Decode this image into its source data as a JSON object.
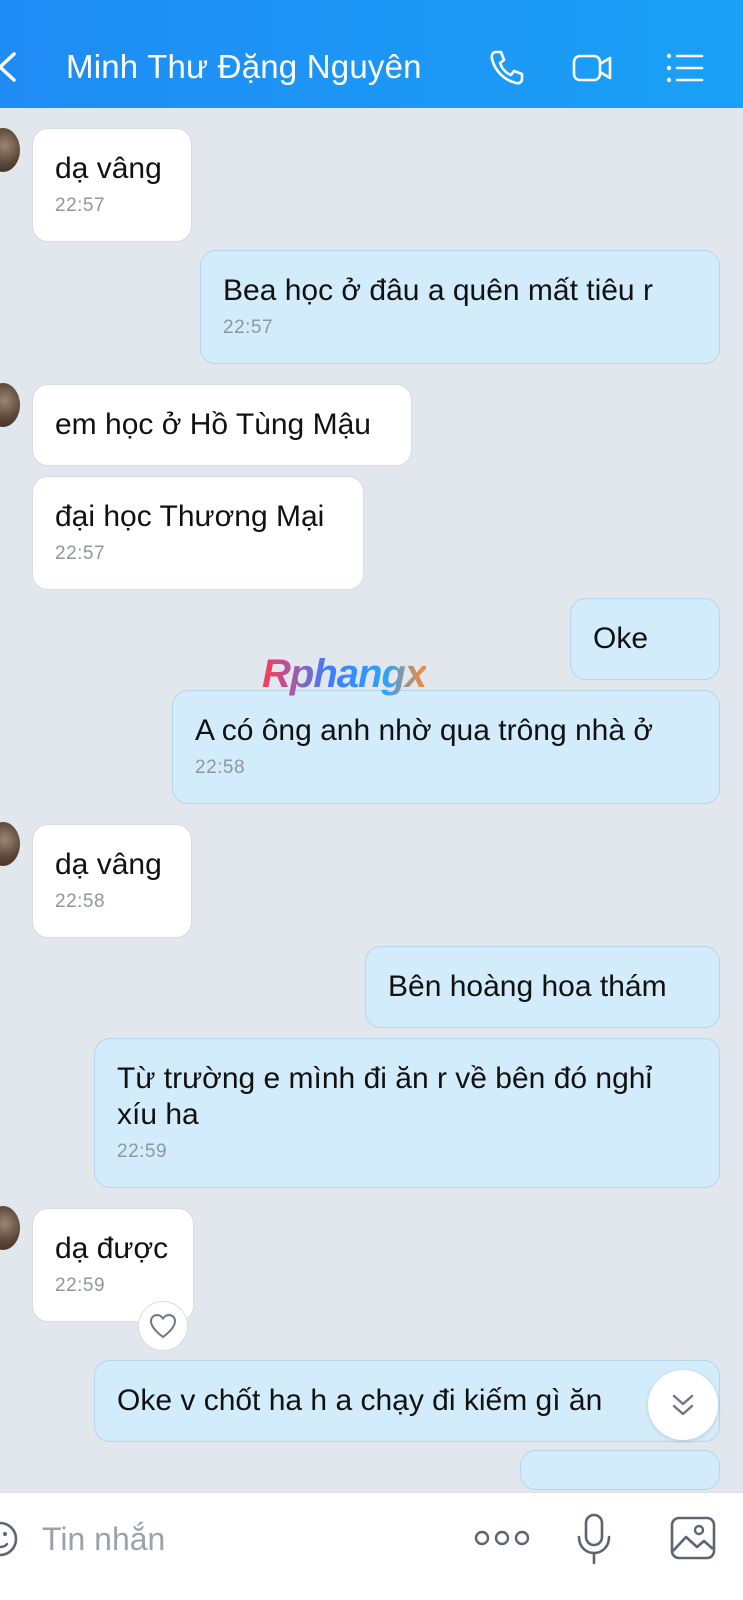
{
  "header": {
    "title": "Minh Thư Đặng Nguyên",
    "icons": [
      "back-icon",
      "phone-icon",
      "video-call-icon",
      "menu-list-icon"
    ]
  },
  "messages": [
    {
      "side": "in",
      "text": "dạ vâng",
      "time": "22:57"
    },
    {
      "side": "out",
      "text": "Bea học ở đâu a quên mất tiêu r",
      "time": "22:57"
    },
    {
      "side": "in",
      "text": "em học ở Hồ Tùng Mậu",
      "time": ""
    },
    {
      "side": "in",
      "text": "đại học Thương Mại",
      "time": "22:57"
    },
    {
      "side": "out",
      "text": "Oke",
      "time": ""
    },
    {
      "side": "out",
      "text": "A có ông anh nhờ qua trông nhà ở",
      "time": "22:58"
    },
    {
      "side": "in",
      "text": "dạ vâng",
      "time": "22:58"
    },
    {
      "side": "out",
      "text": "Bên hoàng hoa thám",
      "time": ""
    },
    {
      "side": "out",
      "text": "Từ trường e mình đi ăn r về bên đó nghỉ xíu ha",
      "time": "22:59"
    },
    {
      "side": "in",
      "text": "dạ được",
      "time": "22:59"
    },
    {
      "side": "out",
      "text": "Oke v chốt ha h a chạy đi kiếm gì ăn",
      "time": ""
    }
  ],
  "watermark": "Rphangx",
  "input": {
    "placeholder": "Tin nhắn"
  },
  "colors": {
    "header": "#1f8cf5",
    "outgoing_bubble": "#d3ecfb",
    "incoming_bubble": "#ffffff",
    "background": "#e2e7ee"
  }
}
